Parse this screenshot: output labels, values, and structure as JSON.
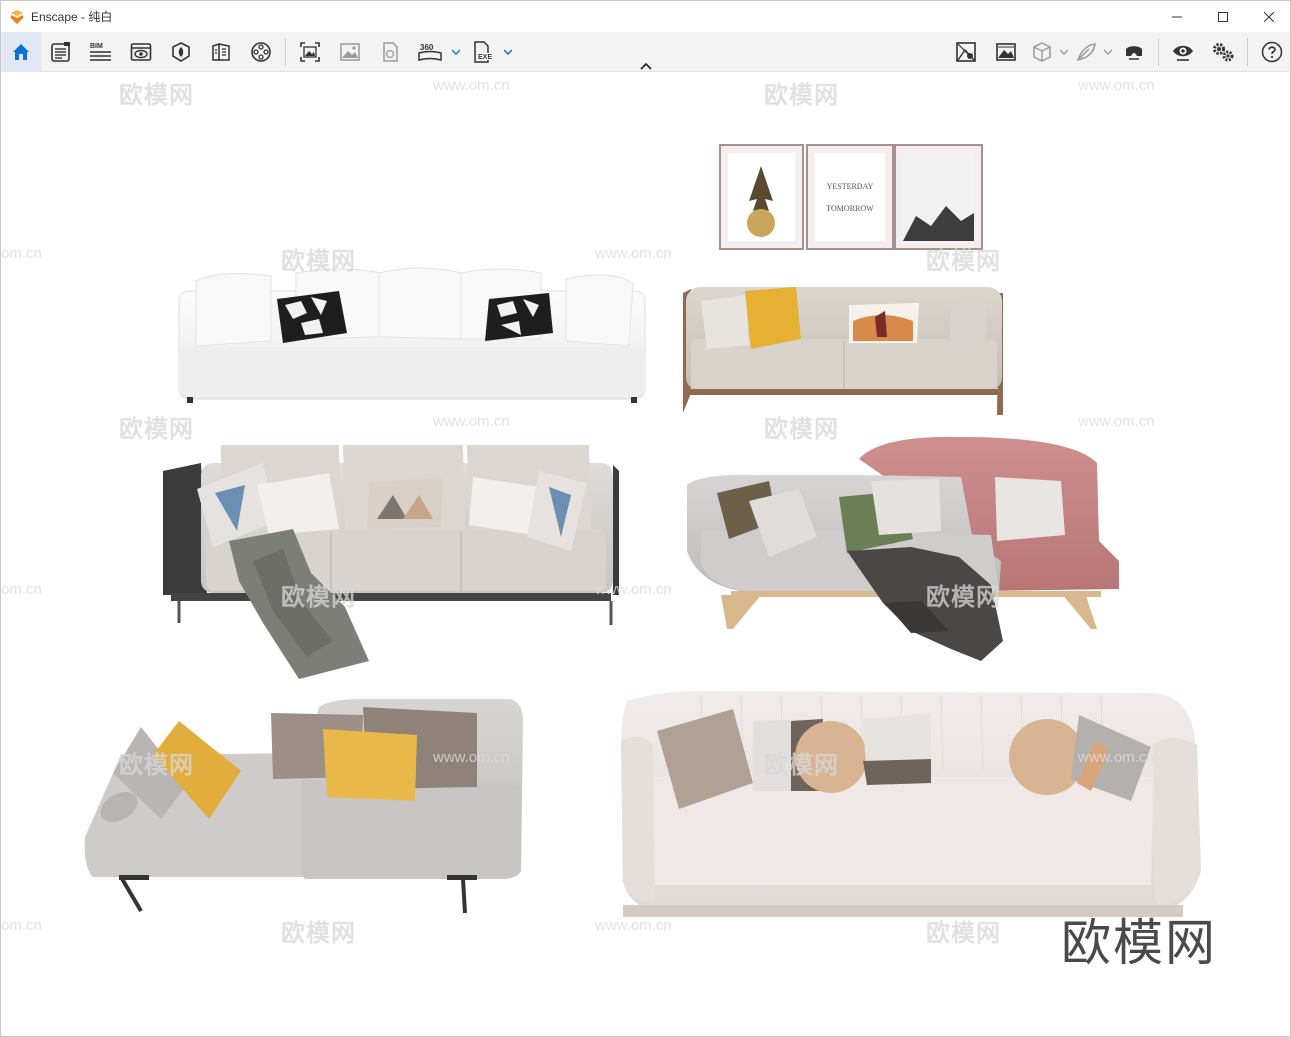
{
  "window": {
    "title": "Enscape - 纯白"
  },
  "toolbar": {
    "left_icons": [
      "home-icon",
      "views-icon",
      "bim-icon",
      "visual-settings-icon",
      "asset-library-icon",
      "material-editor-icon",
      "video-editor-icon",
      "screenshot-icon",
      "batch-render-icon",
      "panorama-icon",
      "360-icon",
      "exe-export-icon"
    ],
    "right_icons": [
      "atmosphere-icon",
      "image-icon",
      "cube-icon",
      "feather-icon",
      "vr-headset-icon",
      "eye-icon",
      "settings-icon",
      "help-icon"
    ],
    "bim_label": "BIM",
    "label_360": "360",
    "exe_label": "EXE"
  },
  "viewport": {
    "watermark_brand": "欧模网",
    "watermark_url": "www.om.cn",
    "watermark_url_partial": "om.cn",
    "poster_text_1": "YESTERDAY",
    "poster_text_2": "TOMORROW"
  },
  "colors": {
    "accent": "#0a72d6",
    "logo_orange": "#f39a1e",
    "toolbar_bg": "#f3f3f3"
  }
}
